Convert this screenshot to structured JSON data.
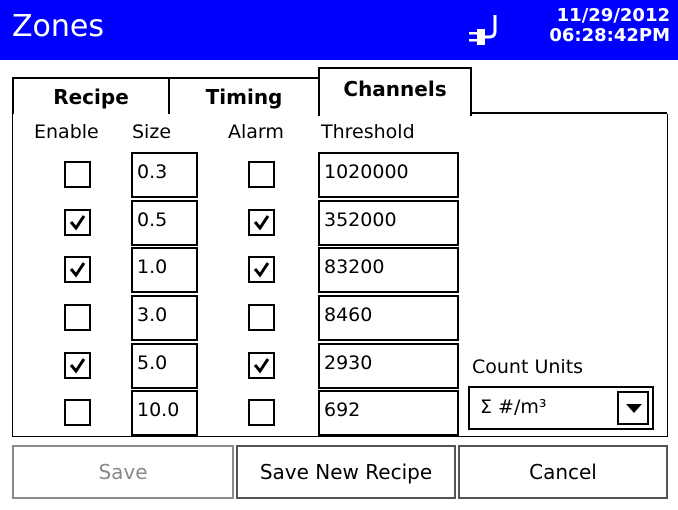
{
  "title_bar": {
    "title": "Zones",
    "date": "11/29/2012",
    "time": "06:28:42PM",
    "status_icon": "power-plug-icon"
  },
  "tabs": [
    {
      "label": "Recipe",
      "active": false
    },
    {
      "label": "Timing",
      "active": false
    },
    {
      "label": "Channels",
      "active": true
    }
  ],
  "columns": {
    "enable": "Enable",
    "size": "Size",
    "alarm": "Alarm",
    "threshold": "Threshold"
  },
  "rows": [
    {
      "enable": false,
      "size": "0.3",
      "alarm": false,
      "threshold": "1020000"
    },
    {
      "enable": true,
      "size": "0.5",
      "alarm": true,
      "threshold": "352000"
    },
    {
      "enable": true,
      "size": "1.0",
      "alarm": true,
      "threshold": "83200"
    },
    {
      "enable": false,
      "size": "3.0",
      "alarm": false,
      "threshold": "8460"
    },
    {
      "enable": true,
      "size": "5.0",
      "alarm": true,
      "threshold": "2930"
    },
    {
      "enable": false,
      "size": "10.0",
      "alarm": false,
      "threshold": "692"
    }
  ],
  "count_units": {
    "label": "Count Units",
    "selected": "Σ #/m³"
  },
  "buttons": {
    "save": "Save",
    "save_new": "Save New Recipe",
    "cancel": "Cancel"
  },
  "colors": {
    "title_bar": "#0000ff",
    "disabled_text": "#8a8a8a"
  }
}
